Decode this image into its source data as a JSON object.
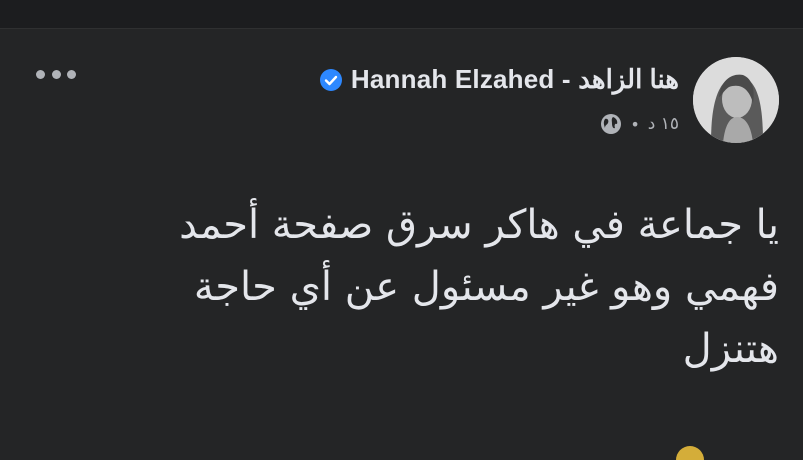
{
  "header": {
    "author_name": "Hannah Elzahed - هنا الزاهد",
    "time": "١٥ د",
    "separator": "•"
  },
  "post": {
    "lines": [
      "يا جماعة في هاكر سرق صفحة أحمد",
      "فهمي وهو غير مسئول عن أي حاجة",
      "هتنزل"
    ]
  },
  "icons": {
    "verified": "verified-badge-icon",
    "privacy": "globe-icon",
    "menu": "more-options-icon"
  },
  "colors": {
    "background": "#242526",
    "text": "#e4e6eb",
    "secondary_text": "#b0b3b8",
    "verified": "#2d88ff"
  }
}
